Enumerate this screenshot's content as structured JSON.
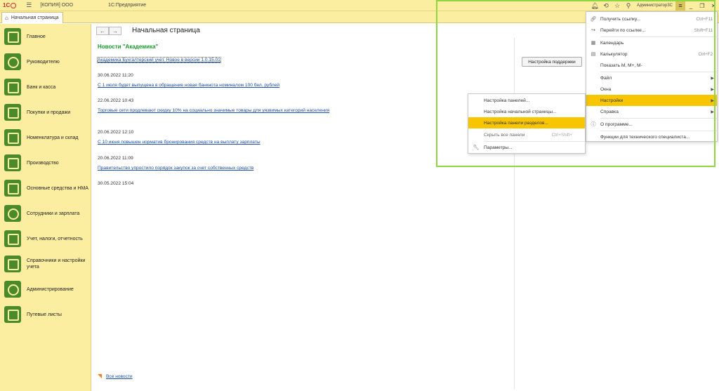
{
  "titlebar": {
    "logo": "1С",
    "copy_label": "[КОПИЯ] ООО",
    "app_name": "1С:Предприятие",
    "user": "Администратор3С"
  },
  "tab": {
    "label": "Начальная страница"
  },
  "sidebar": {
    "items": [
      {
        "label": "Главное"
      },
      {
        "label": "Руководителю"
      },
      {
        "label": "Банк и касса"
      },
      {
        "label": "Покупки и продажи"
      },
      {
        "label": "Номенклатура и склад"
      },
      {
        "label": "Производство"
      },
      {
        "label": "Основные средства и НМА"
      },
      {
        "label": "Сотрудники и зарплата"
      },
      {
        "label": "Учет, налоги, отчетность"
      },
      {
        "label": "Справочники и настройки учета"
      },
      {
        "label": "Администрирование"
      },
      {
        "label": "Путевые листы"
      }
    ]
  },
  "main": {
    "title": "Начальная страница",
    "news_title": "Новости \"Академика\"",
    "support_button": "Настройка поддержки",
    "all_news": "Все новости",
    "news": [
      {
        "date": "",
        "link": "Академика Бухгалтерский учет. Новое в версии 1.0.15.01"
      },
      {
        "date": "30.06.2022 11:20",
        "link": "С 1 июля будет выпущена в обращение новая банкнота номиналом 100 бел. рублей"
      },
      {
        "date": "22.06.2022 10:43",
        "link": "Торговые сети продлевают скидку 10% на социально значимые товары для уязвимых категорий населения"
      },
      {
        "date": "20.06.2022 12:10",
        "link": "С 10 июня повышен норматив бронирования средств на выплату зарплаты"
      },
      {
        "date": "20.06.2022 11:09",
        "link": "Правительство упростило порядок закупок за счет собственных средств"
      },
      {
        "date": "30.05.2022 15:04",
        "link": ""
      }
    ]
  },
  "menu": {
    "items": [
      {
        "label": "Получить ссылку...",
        "shortcut": "Ctrl+F11"
      },
      {
        "label": "Перейти по ссылке...",
        "shortcut": "Shift+F11"
      },
      {
        "label": "Календарь",
        "shortcut": ""
      },
      {
        "label": "Калькулятор",
        "shortcut": "Ctrl+F2"
      },
      {
        "label": "Показать М, М+, М-",
        "shortcut": ""
      },
      {
        "label": "Файл",
        "shortcut": ""
      },
      {
        "label": "Окна",
        "shortcut": ""
      },
      {
        "label": "Настройки",
        "shortcut": ""
      },
      {
        "label": "Справка",
        "shortcut": ""
      },
      {
        "label": "О программе...",
        "shortcut": ""
      },
      {
        "label": "Функции для технического специалиста...",
        "shortcut": ""
      }
    ]
  },
  "submenu": {
    "items": [
      {
        "label": "Настройка панелей...",
        "shortcut": ""
      },
      {
        "label": "Настройка начальной страницы...",
        "shortcut": ""
      },
      {
        "label": "Настройка панели разделов...",
        "shortcut": ""
      },
      {
        "label": "Скрыть все панели",
        "shortcut": "Ctrl+Shift+`"
      },
      {
        "label": "Параметры...",
        "shortcut": ""
      }
    ]
  },
  "colors": {
    "panel_yellow": "#fbeea0",
    "selected": "#f7c600",
    "news_green": "#1a9a2a",
    "link_blue": "#1a4da8",
    "highlight_frame": "#8fd640"
  }
}
